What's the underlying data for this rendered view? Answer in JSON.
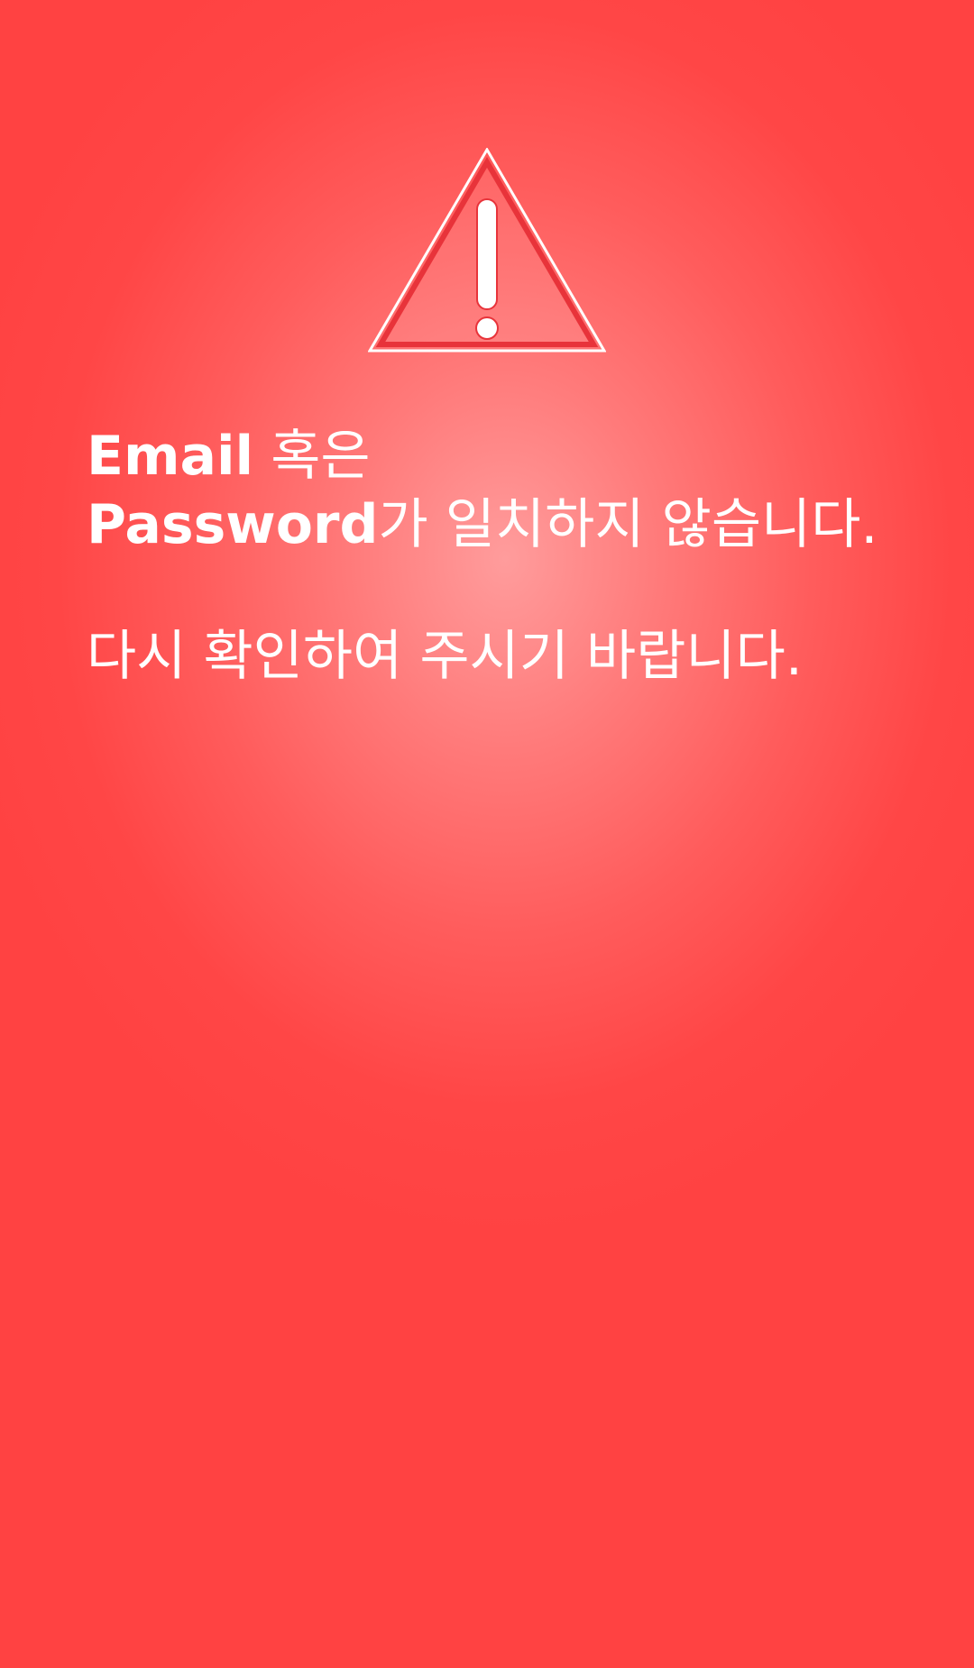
{
  "alert": {
    "icon": "warning-triangle-icon",
    "line1_bold": "Email",
    "line1_normal": " 혹은",
    "line2_bold": "Password",
    "line2_normal": "가 일치하지 않습니다.",
    "line3": "다시 확인하여 주시기 바랍니다."
  },
  "colors": {
    "background": "#ff4444",
    "text": "#ffffff"
  }
}
